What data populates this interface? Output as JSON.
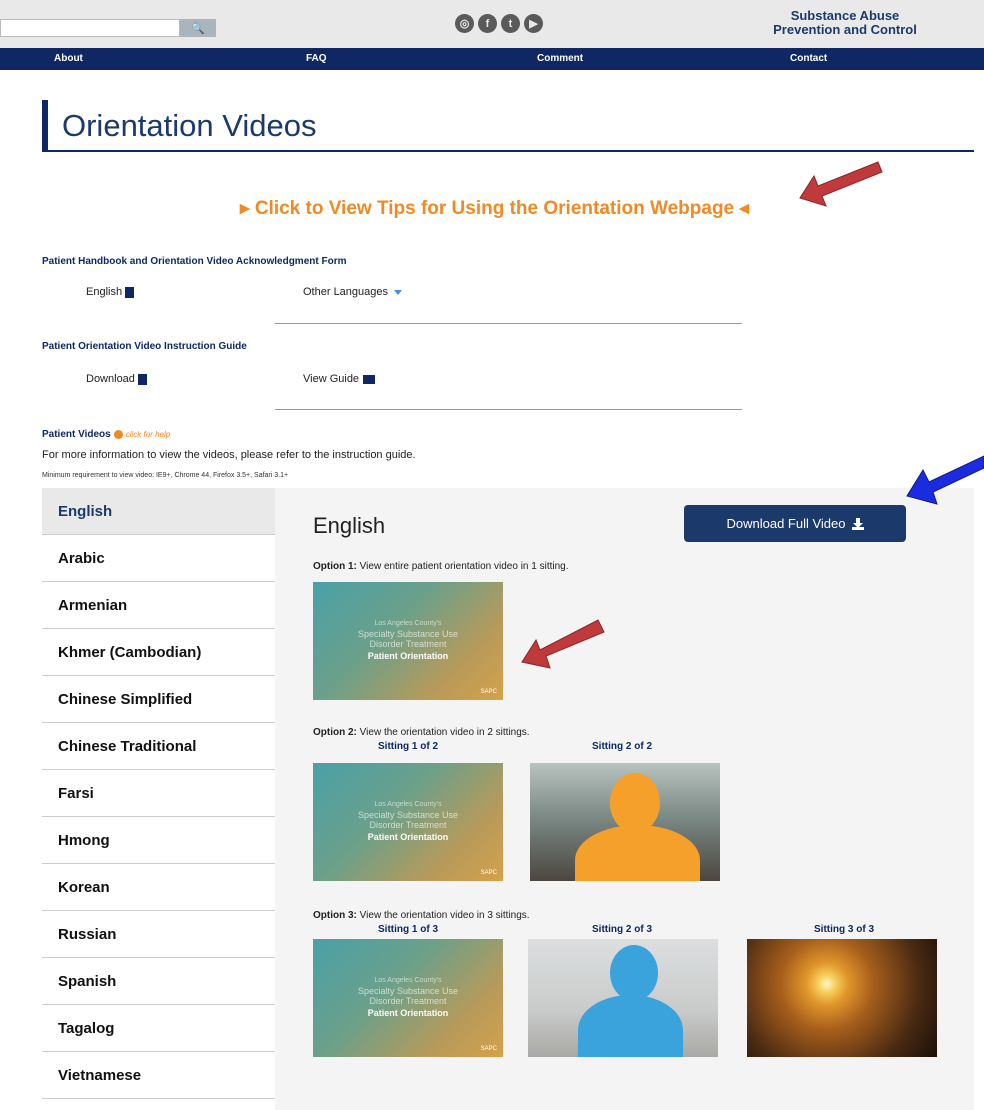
{
  "header": {
    "search_placeholder": "",
    "search_button_glyph": "🔍",
    "social_icons": [
      "instagram-icon",
      "facebook-icon",
      "twitter-icon",
      "youtube-icon"
    ],
    "brand_line1": "Substance Abuse",
    "brand_line2": "Prevention and Control"
  },
  "nav": {
    "items": [
      "About",
      "FAQ",
      "Comment",
      "Contact"
    ]
  },
  "page": {
    "title": "Orientation Videos",
    "tips_link": "▸ Click to View Tips for Using the Orientation Webpage ◂"
  },
  "handbook": {
    "heading": "Patient Handbook and Orientation Video Acknowledgment Form",
    "english": "English",
    "other": "Other Languages"
  },
  "guide": {
    "heading": "Patient Orientation Video Instruction Guide",
    "download": "Download",
    "view": "View Guide"
  },
  "patient_videos": {
    "heading": "Patient Videos",
    "help": "click for help",
    "info": "For more information to view the videos, please refer to the instruction guide.",
    "min_req": "Minimum requirement to view video: IE9+, Chrome 44, Firefox 3.5+, Safari 3.1+"
  },
  "languages": [
    "English",
    "Arabic",
    "Armenian",
    "Khmer (Cambodian)",
    "Chinese Simplified",
    "Chinese Traditional",
    "Farsi",
    "Hmong",
    "Korean",
    "Russian",
    "Spanish",
    "Tagalog",
    "Vietnamese"
  ],
  "active_language": "English",
  "content": {
    "title": "English",
    "download_button": "Download Full Video",
    "option1_bold": "Option 1:",
    "option1_text": " View entire patient orientation video in 1 sitting.",
    "option2_bold": "Option 2:",
    "option2_text": " View the orientation video in 2 sittings.",
    "option3_bold": "Option 3:",
    "option3_text": " View the orientation video in 3 sittings.",
    "sitting_1_of_2": "Sitting 1 of 2",
    "sitting_2_of_2": "Sitting 2 of 2",
    "sitting_1_of_3": "Sitting 1 of 3",
    "sitting_2_of_3": "Sitting 2 of 3",
    "sitting_3_of_3": "Sitting 3 of 3",
    "thumb_line1": "Los Angeles County's",
    "thumb_line2a": "Specialty Substance Use",
    "thumb_line2b": "Disorder Treatment",
    "thumb_line3": "Patient Orientation",
    "thumb_logo": "SAPC"
  },
  "colors": {
    "navy": "#0f2863",
    "orange": "#f08a24",
    "annotation_red": "#c0393b",
    "annotation_blue": "#1a2be0",
    "silhouette_orange": "#f5a02a",
    "silhouette_blue": "#3aa3dc"
  }
}
